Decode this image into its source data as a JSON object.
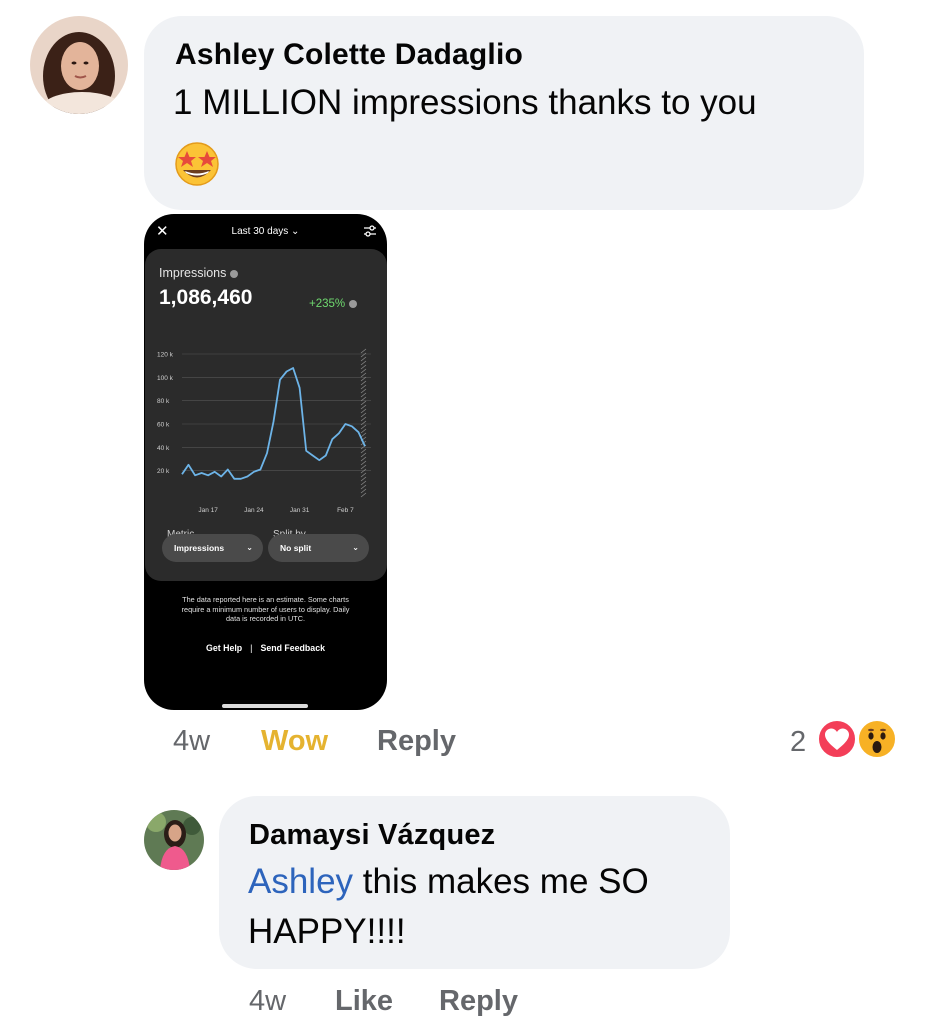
{
  "comments": [
    {
      "author": "Ashley Colette Dadaglio",
      "text": "1 MILLION impressions thanks to you",
      "emoji": "🤩",
      "time": "4w",
      "reaction_action": "Wow",
      "reply_label": "Reply",
      "reaction_count": "2",
      "reaction_icons": [
        "heart-icon",
        "wow-icon"
      ]
    },
    {
      "author": "Damaysi Vázquez",
      "mention": "Ashley",
      "text_line1": " this makes me SO",
      "text_line2": "HAPPY!!!!",
      "time": "4w",
      "like_label": "Like",
      "reply_label": "Reply"
    }
  ],
  "attachment": {
    "range_label": "Last 30 days",
    "metric_title": "Impressions",
    "total": "1,086,460",
    "change": "+235%",
    "metric_field_label": "Metric",
    "metric_value": "Impressions",
    "split_field_label": "Split by",
    "split_value": "No split",
    "disclaimer": "The data reported here is an estimate. Some charts require a minimum number of users to display. Daily data is recorded in UTC.",
    "link_help": "Get Help",
    "link_feedback": "Send Feedback",
    "chart_data": {
      "type": "line",
      "title": "",
      "xlabel": "",
      "ylabel": "",
      "y_ticks": [
        "120 k",
        "100 k",
        "80 k",
        "60 k",
        "40 k",
        "20 k"
      ],
      "y_tick_values": [
        120000,
        100000,
        80000,
        60000,
        40000,
        20000
      ],
      "x_ticks": [
        "Jan 17",
        "Jan 24",
        "Jan 31",
        "Feb 7"
      ],
      "x_tick_days": [
        4,
        11,
        18,
        25
      ],
      "ylim": [
        0,
        120000
      ],
      "line_color": "#6db4e8",
      "series": [
        {
          "x_days": [
            0,
            1,
            2,
            3,
            4,
            5,
            6,
            7,
            8,
            9,
            10,
            11,
            12,
            13,
            14,
            15,
            16,
            17,
            18,
            19,
            20,
            21,
            22,
            23,
            24,
            25,
            26,
            27,
            28
          ],
          "values": [
            17000,
            25000,
            16000,
            18000,
            16000,
            19000,
            15000,
            21000,
            13000,
            13000,
            15000,
            19000,
            21000,
            35000,
            62000,
            98000,
            105000,
            108000,
            91000,
            37000,
            33000,
            29000,
            33000,
            47000,
            52000,
            60000,
            58000,
            53000,
            41000
          ]
        }
      ],
      "legend": "none",
      "grid": true
    }
  },
  "colors": {
    "bubble": "#f0f2f5",
    "meta": "#65676b",
    "wow": "#e5b330",
    "mention": "#2d64bc",
    "heart": "#f33e58",
    "wow_emoji": "#f7b125"
  }
}
